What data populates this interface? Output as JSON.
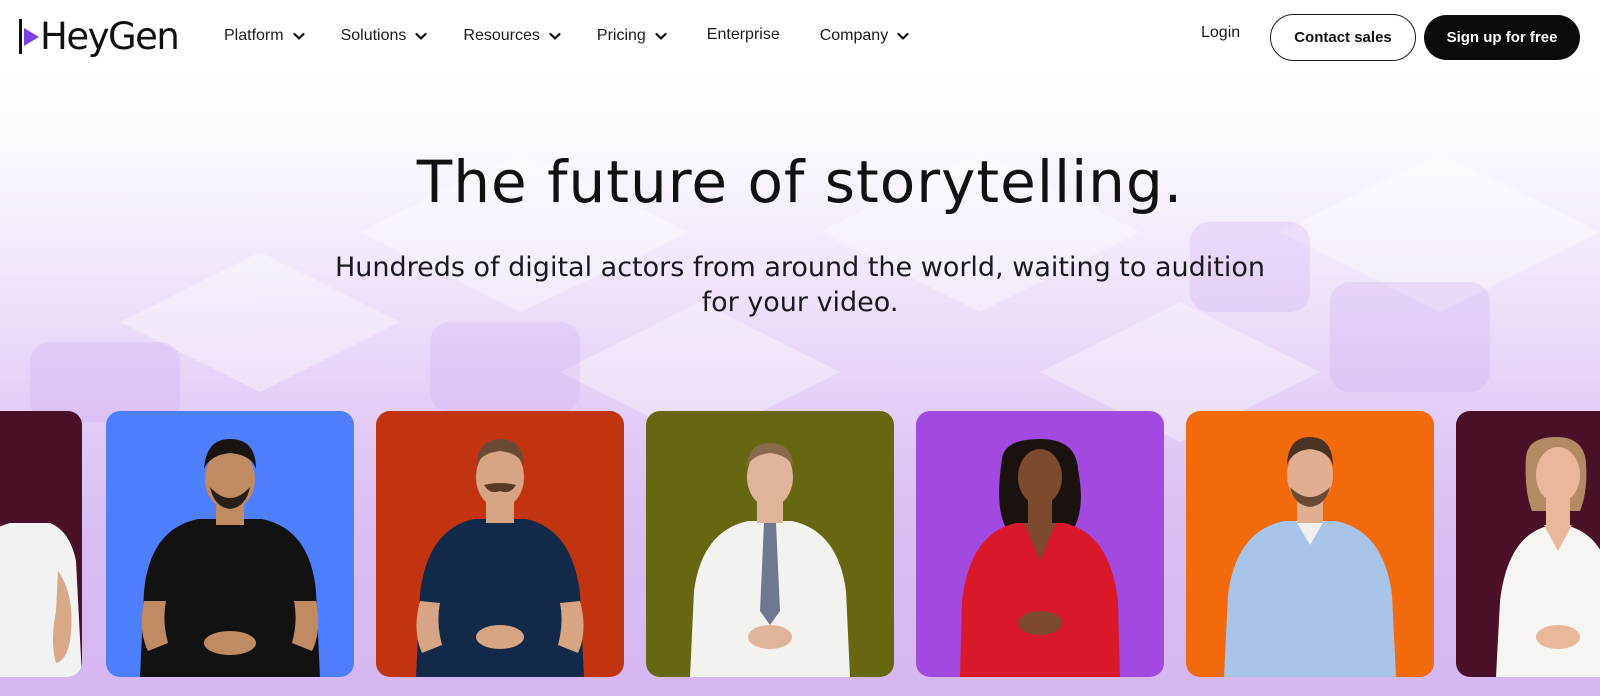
{
  "brand": {
    "logo_text": "HeyGen",
    "logo_icon": "play-triangle-icon",
    "accent_color": "#7b3fe4"
  },
  "nav": {
    "items": [
      {
        "label": "Platform",
        "dropdown": true
      },
      {
        "label": "Solutions",
        "dropdown": true
      },
      {
        "label": "Resources",
        "dropdown": true
      },
      {
        "label": "Pricing",
        "dropdown": true
      },
      {
        "label": "Enterprise",
        "dropdown": false
      },
      {
        "label": "Company",
        "dropdown": true
      }
    ],
    "login_label": "Login",
    "contact_label": "Contact sales",
    "signup_label": "Sign up for free"
  },
  "hero": {
    "title": "The future of storytelling.",
    "subtitle_line1": "Hundreds of digital actors from around the world, waiting to audition",
    "subtitle_line2": "for your video."
  },
  "avatars": [
    {
      "background": "#4a1027",
      "shirt": "#f2f2f2",
      "partial": "left"
    },
    {
      "background": "#4d7ffd",
      "shirt": "#121212"
    },
    {
      "background": "#c2330f",
      "shirt": "#12294a"
    },
    {
      "background": "#676711",
      "shirt": "#f4f2ee",
      "tie": "#6e7890"
    },
    {
      "background": "#a24ae0",
      "shirt": "#d9192a"
    },
    {
      "background": "#f26a0c",
      "shirt": "#a8c4e8"
    },
    {
      "background": "#4a1027",
      "shirt": "#f7f5f2",
      "partial": "right"
    }
  ]
}
